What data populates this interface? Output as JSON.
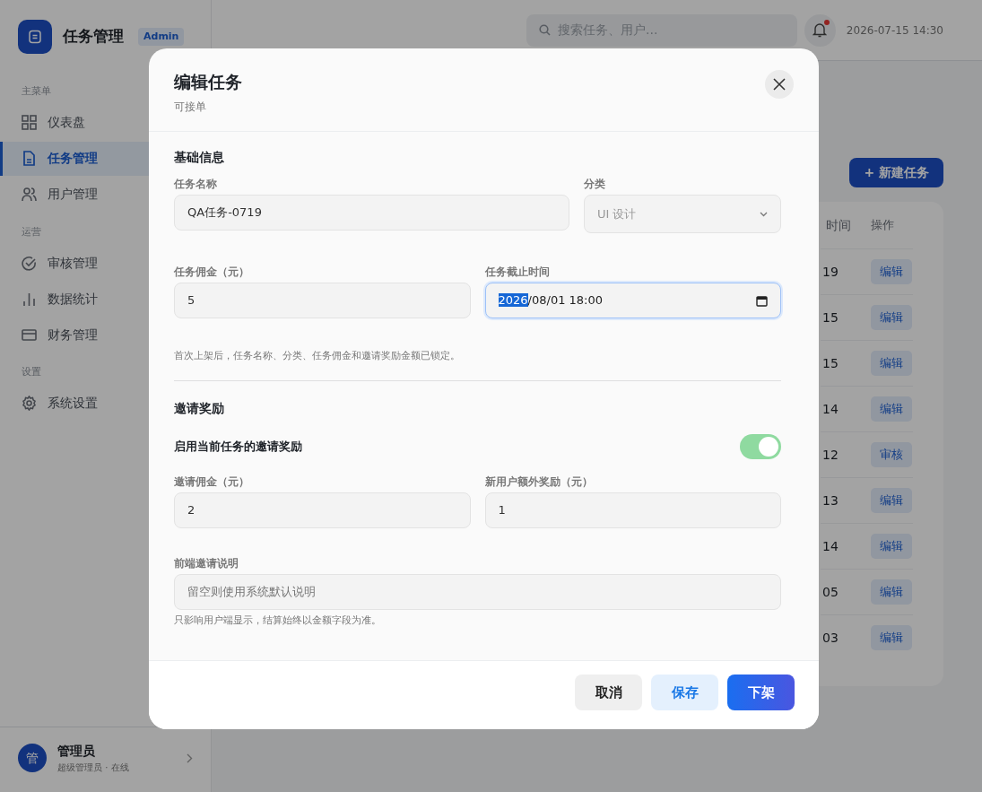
{
  "sidebar": {
    "brand": {
      "title": "任务管理",
      "badge": "Admin"
    },
    "groups": [
      {
        "label": "主菜单",
        "items": [
          {
            "label": "仪表盘",
            "selected": false
          },
          {
            "label": "任务管理",
            "selected": true
          },
          {
            "label": "用户管理",
            "selected": false
          }
        ]
      },
      {
        "label": "运营",
        "items": [
          {
            "label": "审核管理",
            "selected": false
          },
          {
            "label": "数据统计",
            "selected": false
          },
          {
            "label": "财务管理",
            "selected": false
          }
        ]
      },
      {
        "label": "设置",
        "items": [
          {
            "label": "系统设置",
            "selected": false
          }
        ]
      }
    ],
    "user": {
      "avatar": "管",
      "name": "管理员",
      "role": "超级管理员 · 在线"
    }
  },
  "topbar": {
    "search": {
      "placeholder": "搜索任务、用户..."
    },
    "notifications": {
      "unread": true
    },
    "datetime": "2026-07-15 14:30"
  },
  "main": {
    "new_button": "+ 新建任务",
    "table": {
      "columns": [
        "时间",
        "操作"
      ],
      "rows": [
        {
          "time": "19",
          "action": "编辑"
        },
        {
          "time": "15",
          "action": "编辑"
        },
        {
          "time": "15",
          "action": "编辑"
        },
        {
          "time": "14",
          "action": "编辑"
        },
        {
          "time": "12",
          "action": "审核"
        },
        {
          "time": "13",
          "action": "编辑"
        },
        {
          "time": "14",
          "action": "编辑"
        },
        {
          "time": "05",
          "action": "编辑"
        },
        {
          "time": "03",
          "action": "编辑"
        }
      ]
    }
  },
  "modal": {
    "title": "编辑任务",
    "subtitle": "可接单",
    "basic": {
      "heading": "基础信息",
      "name": {
        "label": "任务名称",
        "value": "QA任务-0719"
      },
      "category": {
        "label": "分类",
        "value": "UI 设计",
        "disabled": true
      },
      "commission": {
        "label": "任务佣金（元）",
        "value": "5"
      },
      "deadline": {
        "label": "任务截止时间",
        "value": "2026/08/01 18:00",
        "focused": true
      },
      "note": "首次上架后，任务名称、分类、任务佣金和邀请奖励金额已锁定。"
    },
    "invite": {
      "heading": "邀请奖励",
      "toggle": {
        "label": "启用当前任务的邀请奖励",
        "on": true
      },
      "commission": {
        "label": "邀请佣金（元）",
        "value": "2"
      },
      "bonus": {
        "label": "新用户额外奖励（元）",
        "value": "1"
      },
      "description": {
        "label": "前端邀请说明",
        "placeholder": "留空则使用系统默认说明"
      },
      "note": "只影响用户端显示，结算始终以金额字段为准。"
    },
    "buttons": [
      {
        "label": "取消",
        "kind": "secondary"
      },
      {
        "label": "保存",
        "kind": "soft"
      },
      {
        "label": "下架",
        "kind": "primary"
      }
    ]
  }
}
